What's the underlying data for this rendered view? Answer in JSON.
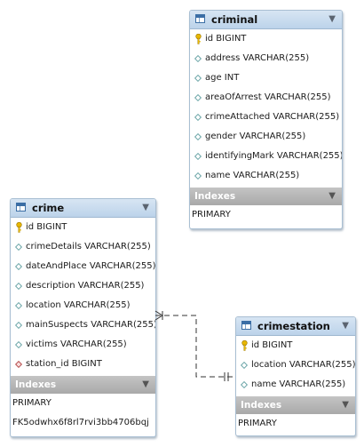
{
  "tables": {
    "criminal": {
      "name": "criminal",
      "columns": [
        {
          "kind": "pk",
          "label": "id BIGINT"
        },
        {
          "kind": "col",
          "label": "address VARCHAR(255)"
        },
        {
          "kind": "col",
          "label": "age INT"
        },
        {
          "kind": "col",
          "label": "areaOfArrest VARCHAR(255)"
        },
        {
          "kind": "col",
          "label": "crimeAttached VARCHAR(255)"
        },
        {
          "kind": "col",
          "label": "gender VARCHAR(255)"
        },
        {
          "kind": "col",
          "label": "identifyingMark VARCHAR(255)"
        },
        {
          "kind": "col",
          "label": "name VARCHAR(255)"
        }
      ],
      "indexes_label": "Indexes",
      "indexes": [
        "PRIMARY"
      ]
    },
    "crime": {
      "name": "crime",
      "columns": [
        {
          "kind": "pk",
          "label": "id BIGINT"
        },
        {
          "kind": "col",
          "label": "crimeDetails VARCHAR(255)"
        },
        {
          "kind": "col",
          "label": "dateAndPlace VARCHAR(255)"
        },
        {
          "kind": "col",
          "label": "description VARCHAR(255)"
        },
        {
          "kind": "col",
          "label": "location VARCHAR(255)"
        },
        {
          "kind": "col",
          "label": "mainSuspects VARCHAR(255)"
        },
        {
          "kind": "col",
          "label": "victims VARCHAR(255)"
        },
        {
          "kind": "fk",
          "label": "station_id BIGINT"
        }
      ],
      "indexes_label": "Indexes",
      "indexes": [
        "PRIMARY",
        "FK5odwhx6f8rl7rvi3bb4706bqj"
      ]
    },
    "crimestation": {
      "name": "crimestation",
      "columns": [
        {
          "kind": "pk",
          "label": "id BIGINT"
        },
        {
          "kind": "col",
          "label": "location VARCHAR(255)"
        },
        {
          "kind": "col",
          "label": "name VARCHAR(255)"
        }
      ],
      "indexes_label": "Indexes",
      "indexes": [
        "PRIMARY"
      ]
    }
  },
  "colors": {
    "header_top": "#d7e5f3",
    "header_bottom": "#bcd3ea",
    "index_header": "#b3b3b3",
    "column_icon": "#5f9ea0",
    "fk_icon": "#b04040",
    "key_icon": "#e0b000",
    "relationship_line": "#333333"
  }
}
